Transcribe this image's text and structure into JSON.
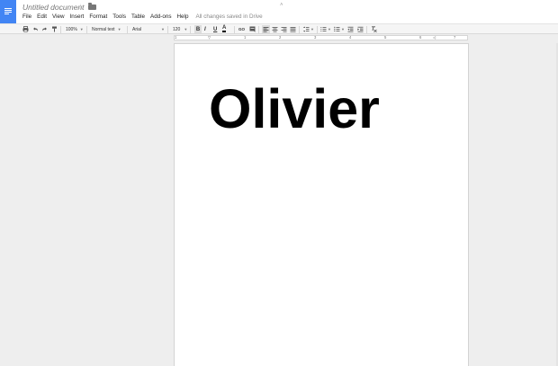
{
  "document": {
    "title": "Untitled document",
    "body_text": "Olivier"
  },
  "header": {
    "star_icon": "☆",
    "collapse_icon": "˄"
  },
  "menu": {
    "items": [
      "File",
      "Edit",
      "View",
      "Insert",
      "Format",
      "Tools",
      "Table",
      "Add-ons",
      "Help"
    ],
    "save_status": "All changes saved in Drive"
  },
  "toolbar": {
    "zoom": "100%",
    "style": "Normal text",
    "font": "Arial",
    "font_size": "120",
    "bold": "B",
    "italic": "I",
    "underline": "U",
    "text_color": "A",
    "link": "GO"
  },
  "ruler": {
    "numbers": [
      "1",
      "1",
      "2",
      "3",
      "4",
      "5",
      "6",
      "7"
    ]
  },
  "colors": {
    "docs_blue": "#4285f4",
    "toolbar_bg": "#f5f5f5",
    "canvas_bg": "#eeeeee"
  }
}
